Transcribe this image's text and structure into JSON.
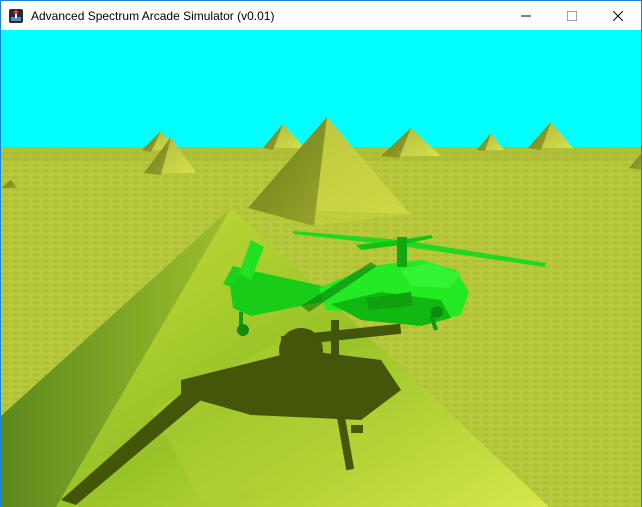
{
  "window": {
    "title": "Advanced Spectrum Arcade Simulator (v0.01)",
    "app_icon": "joystick-app-icon",
    "controls": [
      "minimize-icon",
      "maximize-icon",
      "close-icon"
    ]
  },
  "scene": {
    "sky_color": "#00ffff",
    "ground_color": "#b6c83a",
    "pyramid_color": "#9aa82a",
    "helicopter_color": "#1be01b",
    "shadow_color": "#2f3a05"
  }
}
